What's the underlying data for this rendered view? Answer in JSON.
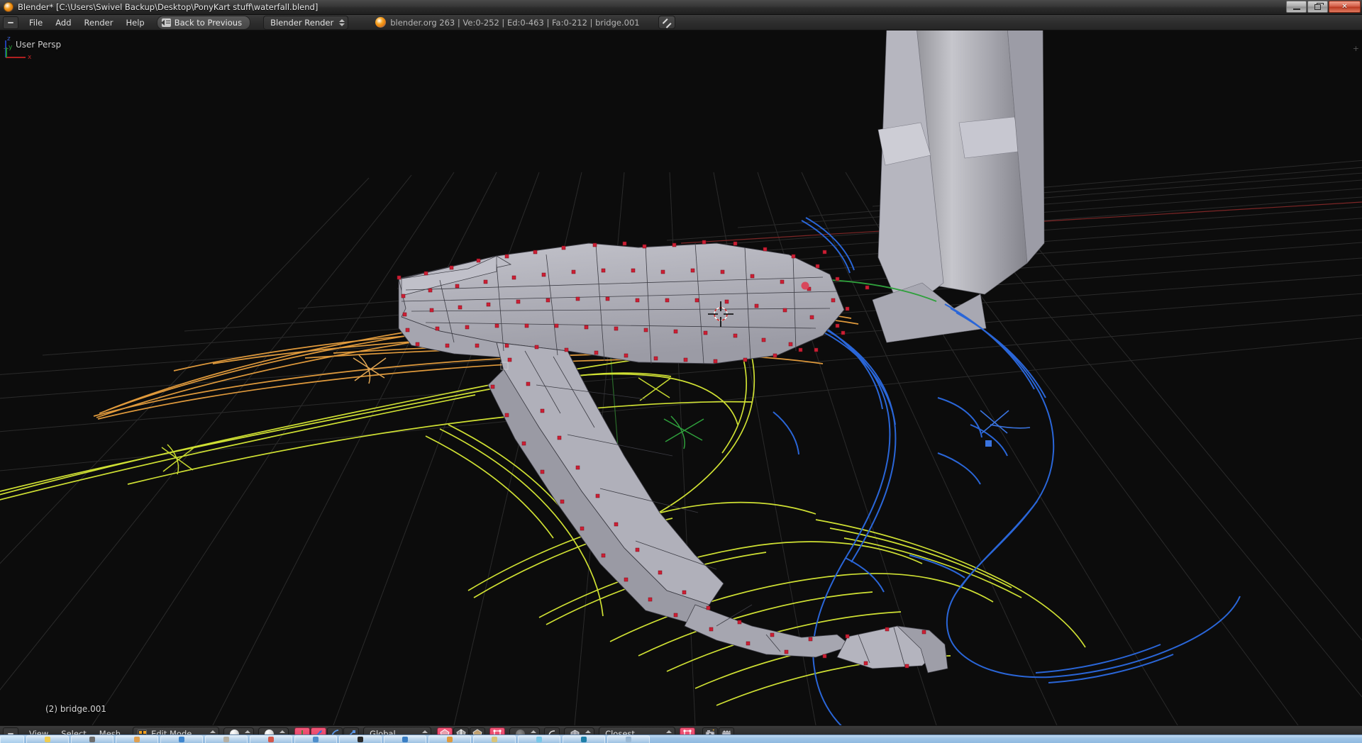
{
  "window": {
    "app_icon": "blender-logo-icon",
    "title": "Blender* [C:\\Users\\Swivel Backup\\Desktop\\PonyKart stuff\\waterfall.blend]",
    "controls": {
      "minimize": "minimize-button",
      "restore": "restore-button",
      "close": "✕"
    }
  },
  "topbar": {
    "editor_type": "info-editor-icon",
    "menus": [
      {
        "label": "File",
        "name": "menu-file"
      },
      {
        "label": "Add",
        "name": "menu-add"
      },
      {
        "label": "Render",
        "name": "menu-render"
      },
      {
        "label": "Help",
        "name": "menu-help"
      }
    ],
    "back_button": {
      "label": "Back to Previous",
      "icon": "back-arrow-icon"
    },
    "render_engine": {
      "value": "Blender Render",
      "icon": "chevron-updown-icon"
    },
    "stats": "blender.org 263 | Ve:0-252 | Ed:0-463 | Fa:0-212 | bridge.001",
    "stats_parts": {
      "version": "blender.org 263",
      "vertices": "Ve:0-252",
      "edges": "Ed:0-463",
      "faces": "Fa:0-212",
      "object": "bridge.001"
    },
    "fullscreen_button": "maximize-area-button"
  },
  "viewport": {
    "view_label": "User Persp",
    "active_object_label": "(2) bridge.001",
    "axis_gizmo": {
      "x": "x",
      "y": "y",
      "z": "z"
    },
    "colors": {
      "background": "#0c0c0c",
      "grid": "#2c2c2c",
      "axis_x": "#8d2b2b",
      "axis_y": "#2e7a2e",
      "mesh_face": "#b4b4bd",
      "mesh_edge": "#3a3a40",
      "vertex_selected": "#cc1f34",
      "curve_selected_green": "#2fa03c",
      "curve_orange": "#e8a33c",
      "curve_yellow": "#d8e030",
      "curve_blue": "#2a66d8",
      "cursor": "#ffffff"
    }
  },
  "bottombar": {
    "editor_type": "3dview-editor-icon",
    "menus": [
      {
        "label": "View",
        "name": "menu-view"
      },
      {
        "label": "Select",
        "name": "menu-select"
      },
      {
        "label": "Mesh",
        "name": "menu-mesh"
      }
    ],
    "mode": {
      "value": "Edit Mode",
      "icon": "edit-mode-icon"
    },
    "viewport_shading": "solid-shading-icon",
    "shading_mode": "material-preview-icon",
    "select_modes": [
      {
        "name": "vertex-select-icon",
        "active": true
      },
      {
        "name": "edge-select-icon",
        "active": false
      },
      {
        "name": "face-select-icon",
        "active": false
      }
    ],
    "manipulator": {
      "toggle": "manipulator-toggle-icon",
      "translate": "translate-manipulator-icon",
      "rotate": "rotate-manipulator-icon",
      "scale": "scale-manipulator-icon"
    },
    "transform_orientation": "Global",
    "pivot": "pivot-median-point-icon",
    "proportional_edit": "proportional-edit-off-icon",
    "snap": {
      "magnet": "snap-magnet-icon",
      "element": "snap-element-icon",
      "target": "Closest"
    },
    "occlude": "occlude-geometry-icon",
    "render_buttons": [
      {
        "name": "render-image-icon"
      },
      {
        "name": "render-animation-icon"
      }
    ]
  },
  "taskbar": {
    "items": [
      {
        "name": "start-button",
        "color": "#7fb2e0"
      },
      {
        "name": "taskbar-item-1",
        "color": "#f0cd50"
      },
      {
        "name": "taskbar-item-2",
        "color": "#6d6d6d"
      },
      {
        "name": "taskbar-item-3",
        "color": "#e0a050"
      },
      {
        "name": "taskbar-item-4",
        "color": "#3f86cf"
      },
      {
        "name": "taskbar-item-5",
        "color": "#b5b0a4"
      },
      {
        "name": "taskbar-item-6",
        "color": "#d4564a"
      },
      {
        "name": "taskbar-item-7",
        "color": "#4e8ecb"
      },
      {
        "name": "taskbar-item-8",
        "color": "#2a2a2a"
      },
      {
        "name": "taskbar-item-9",
        "color": "#3a7ec4"
      },
      {
        "name": "taskbar-item-10",
        "color": "#e09a3c"
      },
      {
        "name": "taskbar-item-11",
        "color": "#d9c478"
      },
      {
        "name": "taskbar-item-12",
        "color": "#79c8e8"
      },
      {
        "name": "taskbar-item-13",
        "color": "#1d7fa8"
      },
      {
        "name": "taskbar-item-14",
        "color": "#9ab8d4"
      }
    ]
  }
}
